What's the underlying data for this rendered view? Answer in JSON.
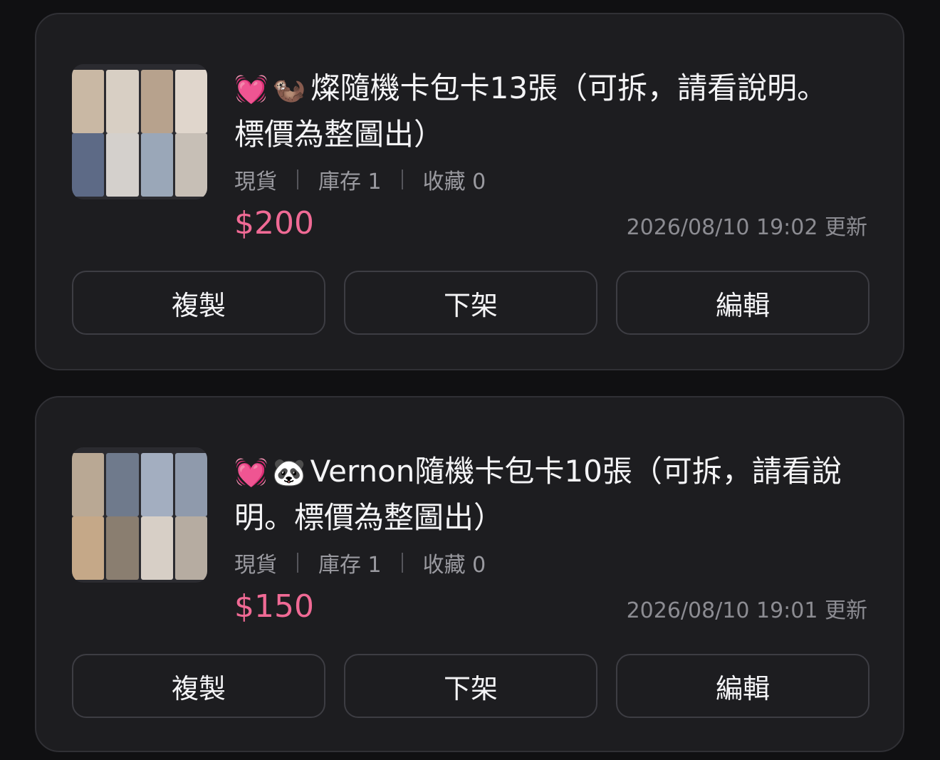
{
  "listings": [
    {
      "emoji1": "💓",
      "emoji2": "🦦",
      "title": "燦隨機卡包卡13張（可拆，請看說明。標價為整圖出）",
      "status": "現貨",
      "stock": "庫存 1",
      "favorites": "收藏 0",
      "price": "$200",
      "updated": "2026/08/10 19:02 更新",
      "buttons": {
        "copy": "複製",
        "unlist": "下架",
        "edit": "編輯"
      }
    },
    {
      "emoji1": "💓",
      "emoji2": "🐼",
      "title": "Vernon隨機卡包卡10張（可拆，請看說明。標價為整圖出）",
      "status": "現貨",
      "stock": "庫存 1",
      "favorites": "收藏 0",
      "price": "$150",
      "updated": "2026/08/10 19:01 更新",
      "buttons": {
        "copy": "複製",
        "unlist": "下架",
        "edit": "編輯"
      }
    }
  ],
  "colors": {
    "price": "#f06a95",
    "card": "#1d1d20",
    "background": "#101012"
  }
}
